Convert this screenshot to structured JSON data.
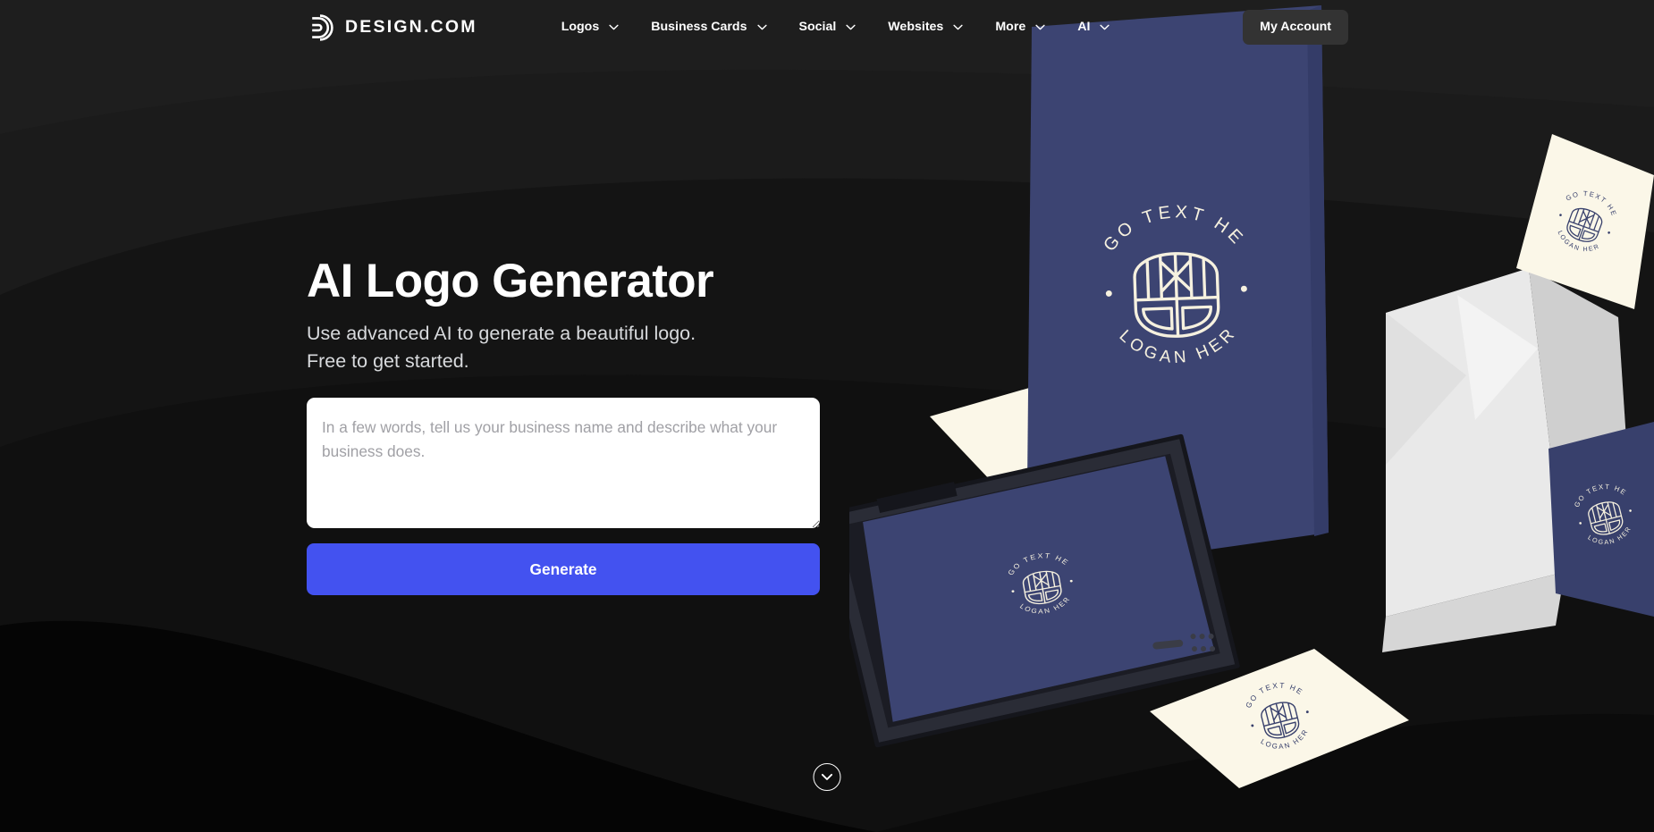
{
  "site": {
    "brand_name": "DESIGN.COM",
    "brand_mark_icon": "design-d-monogram-icon",
    "background_color": "#141414",
    "accent_color": "#4352f0",
    "navy_color": "#3c4472",
    "cream_color": "#fbf7e8"
  },
  "header": {
    "nav": [
      {
        "label": "Logos",
        "icon": "chevron-down-icon"
      },
      {
        "label": "Business Cards",
        "icon": "chevron-down-icon"
      },
      {
        "label": "Social",
        "icon": "chevron-down-icon"
      },
      {
        "label": "Websites",
        "icon": "chevron-down-icon"
      },
      {
        "label": "More",
        "icon": "chevron-down-icon"
      },
      {
        "label": "AI",
        "icon": "chevron-down-icon"
      }
    ],
    "account_label": "My Account"
  },
  "hero": {
    "title": "AI Logo Generator",
    "subtitle_line1": "Use advanced AI to generate a beautiful logo.",
    "subtitle_line2": "Free to get started.",
    "prompt_placeholder": "In a few words, tell us your business name and describe what your business does.",
    "prompt_value": "",
    "generate_label": "Generate"
  },
  "scroll_cue": {
    "icon": "chevron-down-icon"
  },
  "artwork": {
    "logo_text": "LOGO TEXT HERE",
    "slogan_text": "SLOGAN HERE",
    "items": [
      {
        "name": "poster",
        "surface": "navy"
      },
      {
        "name": "phone-mockup",
        "surface": "navy-screen"
      },
      {
        "name": "business-card-left",
        "surface": "cream"
      },
      {
        "name": "business-card-bottom",
        "surface": "cream"
      },
      {
        "name": "business-card-top-right",
        "surface": "cream"
      },
      {
        "name": "business-card-navy-right",
        "surface": "navy"
      },
      {
        "name": "paper-stack",
        "surface": "white"
      }
    ]
  }
}
